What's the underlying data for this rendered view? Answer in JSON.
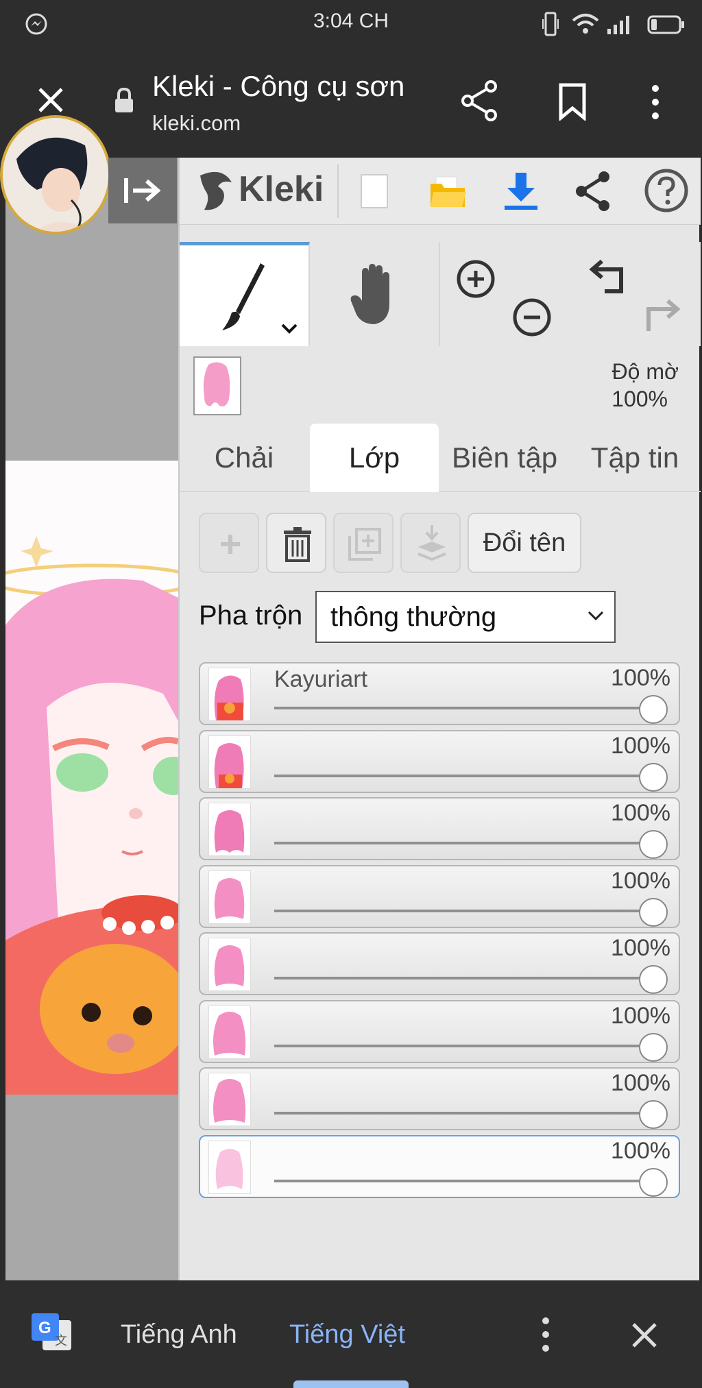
{
  "status_bar": {
    "time": "3:04 CH"
  },
  "browser": {
    "title": "Kleki - Công cụ sơn",
    "url": "kleki.com"
  },
  "kleki": {
    "logo": "Kleki",
    "opacity_label": "Độ mờ",
    "opacity_value": "100%",
    "tabs": [
      "Chải",
      "Lớp",
      "Biên tập",
      "Tập tin"
    ],
    "active_tab": "Lớp",
    "rename_label": "Đổi tên",
    "blend_label": "Pha trộn",
    "blend_value": "thông thường",
    "layers": [
      {
        "name": "Kayuriart",
        "opacity": "100%",
        "opacity_value": 1.0
      },
      {
        "name": "",
        "opacity": "100%",
        "opacity_value": 1.0
      },
      {
        "name": "",
        "opacity": "100%",
        "opacity_value": 1.0
      },
      {
        "name": "",
        "opacity": "100%",
        "opacity_value": 1.0
      },
      {
        "name": "",
        "opacity": "100%",
        "opacity_value": 1.0
      },
      {
        "name": "",
        "opacity": "100%",
        "opacity_value": 1.0
      },
      {
        "name": "",
        "opacity": "100%",
        "opacity_value": 1.0
      },
      {
        "name": "",
        "opacity": "100%",
        "opacity_value": 1.0
      }
    ],
    "selected_layer_index": 7
  },
  "translate_bar": {
    "lang_from": "Tiếng Anh",
    "lang_to": "Tiếng Việt"
  },
  "colors": {
    "accent_blue": "#5b9bd5",
    "lang_active": "#8ab4f8",
    "download_blue": "#1a73e8",
    "folder_yellow": "#f5b800"
  },
  "icons": [
    "messenger-icon",
    "phone-vibrate-icon",
    "wifi-icon",
    "signal-icon",
    "battery-icon",
    "close-icon",
    "lock-icon",
    "share-icon",
    "bookmark-icon",
    "more-vert-icon",
    "collapse-panel-icon",
    "new-file-icon",
    "open-folder-icon",
    "download-icon",
    "help-icon",
    "brush-icon",
    "hand-icon",
    "zoom-in-icon",
    "zoom-out-icon",
    "undo-icon",
    "redo-icon",
    "add-layer-icon",
    "delete-layer-icon",
    "duplicate-layer-icon",
    "merge-down-icon",
    "chevron-down-icon",
    "google-translate-icon"
  ]
}
